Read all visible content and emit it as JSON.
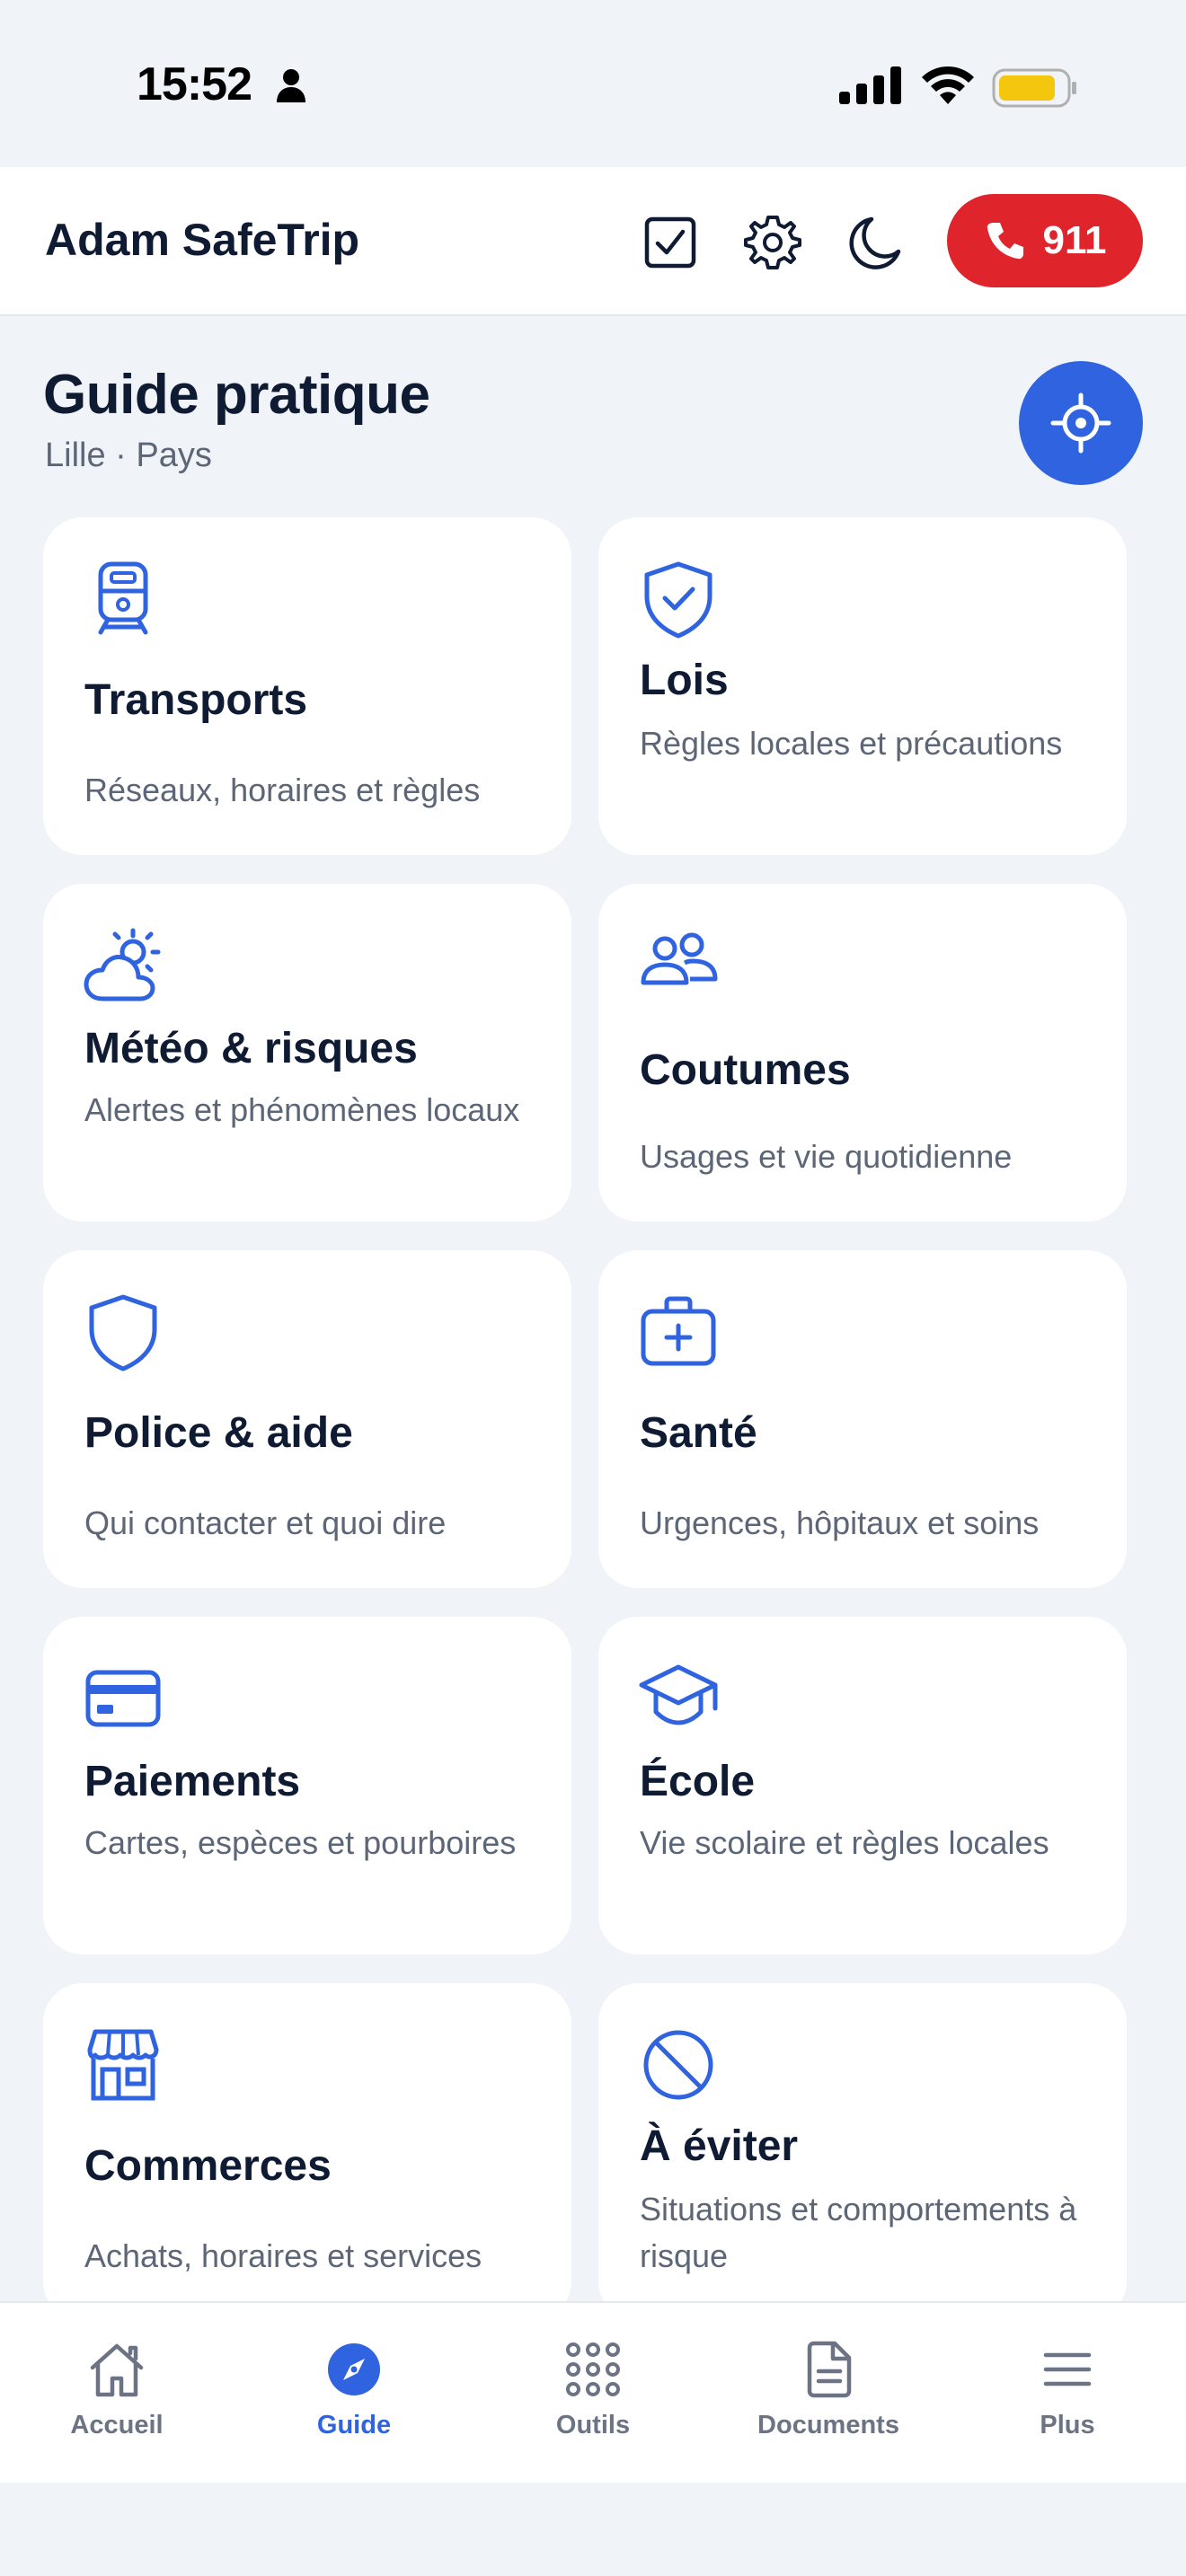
{
  "status": {
    "time": "15:52"
  },
  "header": {
    "title": "Adam SafeTrip",
    "call_label": "911"
  },
  "page": {
    "title": "Guide pratique",
    "subtitle": "Lille · Pays"
  },
  "cards": [
    {
      "icon": "train-icon",
      "title": "Transports",
      "desc": "Réseaux, horaires et règles"
    },
    {
      "icon": "shield-check-icon",
      "title": "Lois",
      "desc": "Règles locales et précautions"
    },
    {
      "icon": "cloud-sun-icon",
      "title": "Météo & risques",
      "desc": "Alertes et phénomènes locaux"
    },
    {
      "icon": "people-icon",
      "title": "Coutumes",
      "desc": "Usages et vie quotidienne"
    },
    {
      "icon": "shield-icon",
      "title": "Police & aide",
      "desc": "Qui contacter et quoi dire"
    },
    {
      "icon": "medical-kit-icon",
      "title": "Santé",
      "desc": "Urgences, hôpitaux et soins"
    },
    {
      "icon": "credit-card-icon",
      "title": "Paiements",
      "desc": "Cartes, espèces et pourboires"
    },
    {
      "icon": "graduation-cap-icon",
      "title": "École",
      "desc": "Vie scolaire et règles locales"
    },
    {
      "icon": "store-icon",
      "title": "Commerces",
      "desc": "Achats, horaires et services"
    },
    {
      "icon": "prohibited-icon",
      "title": "À éviter",
      "desc": "Situations et comportements à risque"
    }
  ],
  "nav": [
    {
      "icon": "home-icon",
      "label": "Accueil"
    },
    {
      "icon": "compass-icon",
      "label": "Guide"
    },
    {
      "icon": "grid-dots-icon",
      "label": "Outils"
    },
    {
      "icon": "document-icon",
      "label": "Documents"
    },
    {
      "icon": "menu-icon",
      "label": "Plus"
    }
  ],
  "colors": {
    "accent": "#2f63e0",
    "emergency": "#e0242b",
    "background": "#f0f3f7",
    "text": "#0f1b33",
    "muted": "#5d6677"
  }
}
